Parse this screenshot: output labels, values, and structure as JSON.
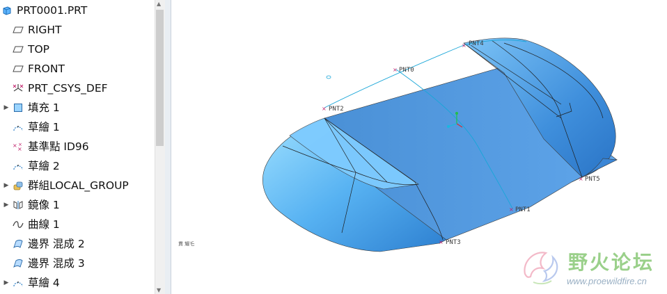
{
  "model_tree": {
    "items": [
      {
        "label": "PRT0001.PRT",
        "icon": "part-icon",
        "expand": ""
      },
      {
        "label": "RIGHT",
        "icon": "datum-plane-icon",
        "expand": ""
      },
      {
        "label": "TOP",
        "icon": "datum-plane-icon",
        "expand": ""
      },
      {
        "label": "FRONT",
        "icon": "datum-plane-icon",
        "expand": ""
      },
      {
        "label": "PRT_CSYS_DEF",
        "icon": "csys-icon",
        "expand": ""
      },
      {
        "label": "填充 1",
        "icon": "fill-icon",
        "expand": "▶"
      },
      {
        "label": "草繪 1",
        "icon": "sketch-icon",
        "expand": ""
      },
      {
        "label": "基準點 ID96",
        "icon": "datum-point-icon",
        "expand": ""
      },
      {
        "label": "草繪 2",
        "icon": "sketch-icon",
        "expand": ""
      },
      {
        "label": "群組LOCAL_GROUP",
        "icon": "group-icon",
        "expand": "▶"
      },
      {
        "label": "鏡像 1",
        "icon": "mirror-icon",
        "expand": "▶"
      },
      {
        "label": "曲線 1",
        "icon": "curve-icon",
        "expand": ""
      },
      {
        "label": "邊界 混成 2",
        "icon": "boundary-blend-icon",
        "expand": ""
      },
      {
        "label": "邊界 混成 3",
        "icon": "boundary-blend-icon",
        "expand": ""
      },
      {
        "label": "草繪 4",
        "icon": "sketch-icon",
        "expand": "▶"
      }
    ]
  },
  "viewport": {
    "points": [
      "PNT0",
      "PNT1",
      "PNT2",
      "PNT3",
      "PNT4",
      "PNT5"
    ],
    "corner_label": "貫 耀乇"
  },
  "watermark": {
    "name": "野火论坛",
    "url": "www.proewildfire.cn"
  },
  "colors": {
    "surface": "#5aa0e6",
    "datum_curve": "#19a6d8",
    "point_marker": "#c0206a"
  }
}
